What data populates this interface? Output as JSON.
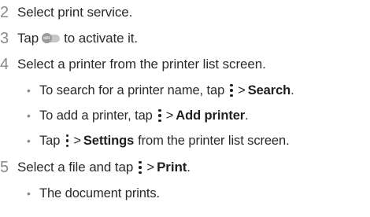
{
  "steps": [
    {
      "number": "2",
      "text": "Select print service."
    },
    {
      "number": "3",
      "text_before": "Tap",
      "toggle_label": "OFF",
      "text_after": "to activate it."
    },
    {
      "number": "4",
      "text": "Select a printer from the printer list screen."
    },
    {
      "number": "5",
      "text_before": "Select a file and tap",
      "gt": ">",
      "action": "Print",
      "text_after": "."
    }
  ],
  "sub_items": [
    {
      "bullet": "•",
      "text_before": "To search for a printer name, tap",
      "gt": ">",
      "action": "Search",
      "text_after": "."
    },
    {
      "bullet": "•",
      "text_before": "To add a printer, tap",
      "gt": ">",
      "action": "Add printer",
      "text_after": "."
    },
    {
      "bullet": "•",
      "text_before": "Tap",
      "gt": ">",
      "action": "Settings",
      "text_after": "from the printer list screen."
    },
    {
      "bullet": "•",
      "text": "The document prints."
    }
  ]
}
